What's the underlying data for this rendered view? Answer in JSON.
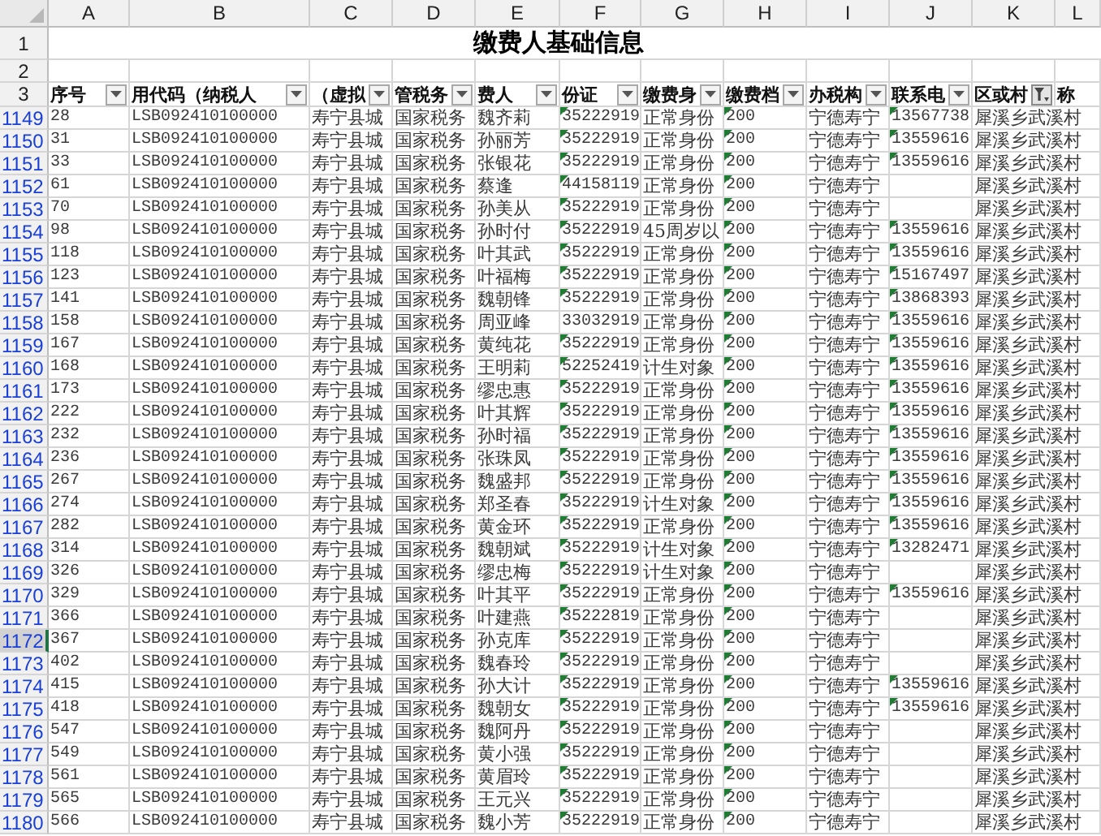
{
  "title": "缴费人基础信息",
  "column_letters": [
    "A",
    "B",
    "C",
    "D",
    "E",
    "F",
    "G",
    "H",
    "I",
    "J",
    "K",
    "L"
  ],
  "top_rows": [
    "1",
    "2",
    "3"
  ],
  "headers": [
    {
      "label": "序号",
      "filtered": false
    },
    {
      "label": "用代码（纳税人",
      "filtered": false
    },
    {
      "label": "（虚拟",
      "filtered": false
    },
    {
      "label": "管税务",
      "filtered": false
    },
    {
      "label": "费人",
      "filtered": false
    },
    {
      "label": "份证",
      "filtered": false
    },
    {
      "label": "缴费身",
      "filtered": false
    },
    {
      "label": "缴费档",
      "filtered": false
    },
    {
      "label": "办税构",
      "filtered": false
    },
    {
      "label": "联系电",
      "filtered": false
    },
    {
      "label": "区或村",
      "filtered": true
    },
    {
      "label": "称"
    }
  ],
  "rows": [
    {
      "row": "1149",
      "selected": false,
      "cells": [
        "28",
        "LSB092410100000",
        "寿宁县城",
        "国家税务",
        "魏齐莉",
        "35222919",
        "正常身份",
        "200",
        "宁德寿宁",
        "13567738",
        "犀溪乡武溪村"
      ],
      "id_flag": true,
      "level_flag": true,
      "phone_flag": true
    },
    {
      "row": "1150",
      "selected": false,
      "cells": [
        "31",
        "LSB092410100000",
        "寿宁县城",
        "国家税务",
        "孙丽芳",
        "35222919",
        "正常身份",
        "200",
        "宁德寿宁",
        "13559616",
        "犀溪乡武溪村"
      ],
      "id_flag": true,
      "level_flag": true,
      "phone_flag": true
    },
    {
      "row": "1151",
      "selected": false,
      "cells": [
        "33",
        "LSB092410100000",
        "寿宁县城",
        "国家税务",
        "张银花",
        "35222919",
        "正常身份",
        "200",
        "宁德寿宁",
        "13559616",
        "犀溪乡武溪村"
      ],
      "id_flag": true,
      "level_flag": true,
      "phone_flag": true
    },
    {
      "row": "1152",
      "selected": false,
      "cells": [
        "61",
        "LSB092410100000",
        "寿宁县城",
        "国家税务",
        "蔡逢",
        "44158119",
        "正常身份",
        "200",
        "宁德寿宁",
        "",
        "犀溪乡武溪村"
      ],
      "id_flag": true,
      "level_flag": true,
      "phone_flag": false
    },
    {
      "row": "1153",
      "selected": false,
      "cells": [
        "70",
        "LSB092410100000",
        "寿宁县城",
        "国家税务",
        "孙美从",
        "35222919",
        "正常身份",
        "200",
        "宁德寿宁",
        "",
        "犀溪乡武溪村"
      ],
      "id_flag": true,
      "level_flag": true,
      "phone_flag": false
    },
    {
      "row": "1154",
      "selected": false,
      "cells": [
        "98",
        "LSB092410100000",
        "寿宁县城",
        "国家税务",
        "孙时付",
        "35222919",
        "45周岁以",
        "200",
        "宁德寿宁",
        "13559616",
        "犀溪乡武溪村"
      ],
      "id_flag": true,
      "level_flag": true,
      "phone_flag": true
    },
    {
      "row": "1155",
      "selected": false,
      "cells": [
        "118",
        "LSB092410100000",
        "寿宁县城",
        "国家税务",
        "叶其武",
        "35222919",
        "正常身份",
        "200",
        "宁德寿宁",
        "13559616",
        "犀溪乡武溪村"
      ],
      "id_flag": true,
      "level_flag": true,
      "phone_flag": true
    },
    {
      "row": "1156",
      "selected": false,
      "cells": [
        "123",
        "LSB092410100000",
        "寿宁县城",
        "国家税务",
        "叶福梅",
        "35222919",
        "正常身份",
        "200",
        "宁德寿宁",
        "15167497",
        "犀溪乡武溪村"
      ],
      "id_flag": true,
      "level_flag": true,
      "phone_flag": true
    },
    {
      "row": "1157",
      "selected": false,
      "cells": [
        "141",
        "LSB092410100000",
        "寿宁县城",
        "国家税务",
        "魏朝锋",
        "35222919",
        "正常身份",
        "200",
        "宁德寿宁",
        "13868393",
        "犀溪乡武溪村"
      ],
      "id_flag": true,
      "level_flag": true,
      "phone_flag": true
    },
    {
      "row": "1158",
      "selected": false,
      "cells": [
        "158",
        "LSB092410100000",
        "寿宁县城",
        "国家税务",
        "周亚峰",
        "33032919",
        "正常身份",
        "200",
        "宁德寿宁",
        "13559616",
        "犀溪乡武溪村"
      ],
      "id_flag": false,
      "level_flag": true,
      "phone_flag": true
    },
    {
      "row": "1159",
      "selected": false,
      "cells": [
        "167",
        "LSB092410100000",
        "寿宁县城",
        "国家税务",
        "黄纯花",
        "35222919",
        "正常身份",
        "200",
        "宁德寿宁",
        "13559616",
        "犀溪乡武溪村"
      ],
      "id_flag": true,
      "level_flag": true,
      "phone_flag": true
    },
    {
      "row": "1160",
      "selected": false,
      "cells": [
        "168",
        "LSB092410100000",
        "寿宁县城",
        "国家税务",
        "王明莉",
        "52252419",
        "计生对象",
        "200",
        "宁德寿宁",
        "13559616",
        "犀溪乡武溪村"
      ],
      "id_flag": true,
      "level_flag": true,
      "phone_flag": true
    },
    {
      "row": "1161",
      "selected": false,
      "cells": [
        "173",
        "LSB092410100000",
        "寿宁县城",
        "国家税务",
        "缪忠惠",
        "35222919",
        "正常身份",
        "200",
        "宁德寿宁",
        "13559616",
        "犀溪乡武溪村"
      ],
      "id_flag": true,
      "level_flag": true,
      "phone_flag": true
    },
    {
      "row": "1162",
      "selected": false,
      "cells": [
        "222",
        "LSB092410100000",
        "寿宁县城",
        "国家税务",
        "叶其辉",
        "35222919",
        "正常身份",
        "200",
        "宁德寿宁",
        "13559616",
        "犀溪乡武溪村"
      ],
      "id_flag": true,
      "level_flag": true,
      "phone_flag": true
    },
    {
      "row": "1163",
      "selected": false,
      "cells": [
        "232",
        "LSB092410100000",
        "寿宁县城",
        "国家税务",
        "孙时福",
        "35222919",
        "正常身份",
        "200",
        "宁德寿宁",
        "13559616",
        "犀溪乡武溪村"
      ],
      "id_flag": true,
      "level_flag": true,
      "phone_flag": true
    },
    {
      "row": "1164",
      "selected": false,
      "cells": [
        "236",
        "LSB092410100000",
        "寿宁县城",
        "国家税务",
        "张珠凤",
        "35222919",
        "正常身份",
        "200",
        "宁德寿宁",
        "13559616",
        "犀溪乡武溪村"
      ],
      "id_flag": true,
      "level_flag": true,
      "phone_flag": true
    },
    {
      "row": "1165",
      "selected": false,
      "cells": [
        "267",
        "LSB092410100000",
        "寿宁县城",
        "国家税务",
        "魏盛邦",
        "35222919",
        "正常身份",
        "200",
        "宁德寿宁",
        "13559616",
        "犀溪乡武溪村"
      ],
      "id_flag": true,
      "level_flag": true,
      "phone_flag": true
    },
    {
      "row": "1166",
      "selected": false,
      "cells": [
        "274",
        "LSB092410100000",
        "寿宁县城",
        "国家税务",
        "郑圣春",
        "35222919",
        "计生对象",
        "200",
        "宁德寿宁",
        "13559616",
        "犀溪乡武溪村"
      ],
      "id_flag": true,
      "level_flag": true,
      "phone_flag": true
    },
    {
      "row": "1167",
      "selected": false,
      "cells": [
        "282",
        "LSB092410100000",
        "寿宁县城",
        "国家税务",
        "黄金环",
        "35222919",
        "正常身份",
        "200",
        "宁德寿宁",
        "13559616",
        "犀溪乡武溪村"
      ],
      "id_flag": true,
      "level_flag": true,
      "phone_flag": true
    },
    {
      "row": "1168",
      "selected": false,
      "cells": [
        "314",
        "LSB092410100000",
        "寿宁县城",
        "国家税务",
        "魏朝斌",
        "35222919",
        "计生对象",
        "200",
        "宁德寿宁",
        "13282471",
        "犀溪乡武溪村"
      ],
      "id_flag": true,
      "level_flag": true,
      "phone_flag": true
    },
    {
      "row": "1169",
      "selected": false,
      "cells": [
        "326",
        "LSB092410100000",
        "寿宁县城",
        "国家税务",
        "缪忠梅",
        "35222919",
        "计生对象",
        "200",
        "宁德寿宁",
        "",
        "犀溪乡武溪村"
      ],
      "id_flag": true,
      "level_flag": true,
      "phone_flag": false
    },
    {
      "row": "1170",
      "selected": false,
      "cells": [
        "329",
        "LSB092410100000",
        "寿宁县城",
        "国家税务",
        "叶其平",
        "35222919",
        "正常身份",
        "200",
        "宁德寿宁",
        "13559616",
        "犀溪乡武溪村"
      ],
      "id_flag": true,
      "level_flag": true,
      "phone_flag": true
    },
    {
      "row": "1171",
      "selected": false,
      "cells": [
        "366",
        "LSB092410100000",
        "寿宁县城",
        "国家税务",
        "叶建燕",
        "35222819",
        "正常身份",
        "200",
        "宁德寿宁",
        "",
        "犀溪乡武溪村"
      ],
      "id_flag": true,
      "level_flag": true,
      "phone_flag": false
    },
    {
      "row": "1172",
      "selected": true,
      "cells": [
        "367",
        "LSB092410100000",
        "寿宁县城",
        "国家税务",
        "孙克库",
        "35222919",
        "正常身份",
        "200",
        "宁德寿宁",
        "",
        "犀溪乡武溪村"
      ],
      "id_flag": true,
      "level_flag": true,
      "phone_flag": false
    },
    {
      "row": "1173",
      "selected": false,
      "cells": [
        "402",
        "LSB092410100000",
        "寿宁县城",
        "国家税务",
        "魏春玲",
        "35222919",
        "正常身份",
        "200",
        "宁德寿宁",
        "",
        "犀溪乡武溪村"
      ],
      "id_flag": true,
      "level_flag": true,
      "phone_flag": false
    },
    {
      "row": "1174",
      "selected": false,
      "cells": [
        "415",
        "LSB092410100000",
        "寿宁县城",
        "国家税务",
        "孙大计",
        "35222919",
        "正常身份",
        "200",
        "宁德寿宁",
        "13559616",
        "犀溪乡武溪村"
      ],
      "id_flag": true,
      "level_flag": true,
      "phone_flag": true
    },
    {
      "row": "1175",
      "selected": false,
      "cells": [
        "418",
        "LSB092410100000",
        "寿宁县城",
        "国家税务",
        "魏朝女",
        "35222919",
        "正常身份",
        "200",
        "宁德寿宁",
        "13559616",
        "犀溪乡武溪村"
      ],
      "id_flag": true,
      "level_flag": true,
      "phone_flag": true
    },
    {
      "row": "1176",
      "selected": false,
      "cells": [
        "547",
        "LSB092410100000",
        "寿宁县城",
        "国家税务",
        "魏阿丹",
        "35222919",
        "正常身份",
        "200",
        "宁德寿宁",
        "",
        "犀溪乡武溪村"
      ],
      "id_flag": true,
      "level_flag": true,
      "phone_flag": false
    },
    {
      "row": "1177",
      "selected": false,
      "cells": [
        "549",
        "LSB092410100000",
        "寿宁县城",
        "国家税务",
        "黄小强",
        "35222919",
        "正常身份",
        "200",
        "宁德寿宁",
        "",
        "犀溪乡武溪村"
      ],
      "id_flag": true,
      "level_flag": true,
      "phone_flag": false
    },
    {
      "row": "1178",
      "selected": false,
      "cells": [
        "561",
        "LSB092410100000",
        "寿宁县城",
        "国家税务",
        "黄眉玲",
        "35222919",
        "正常身份",
        "200",
        "宁德寿宁",
        "",
        "犀溪乡武溪村"
      ],
      "id_flag": true,
      "level_flag": true,
      "phone_flag": false
    },
    {
      "row": "1179",
      "selected": false,
      "cells": [
        "565",
        "LSB092410100000",
        "寿宁县城",
        "国家税务",
        "王元兴",
        "35222919",
        "正常身份",
        "200",
        "宁德寿宁",
        "",
        "犀溪乡武溪村"
      ],
      "id_flag": true,
      "level_flag": true,
      "phone_flag": false
    },
    {
      "row": "1180",
      "selected": false,
      "cells": [
        "566",
        "LSB092410100000",
        "寿宁县城",
        "国家税务",
        "魏小芳",
        "35222919",
        "正常身份",
        "200",
        "宁德寿宁",
        "",
        "犀溪乡武溪村"
      ],
      "id_flag": true,
      "level_flag": true,
      "phone_flag": false
    }
  ]
}
